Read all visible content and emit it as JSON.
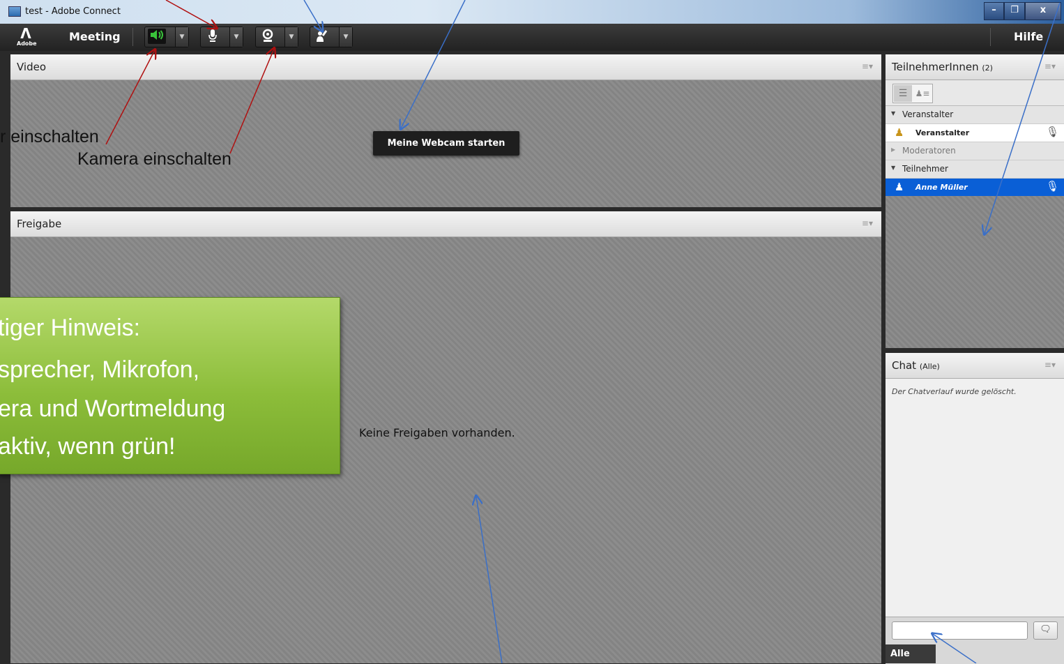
{
  "window": {
    "title": "test - Adobe Connect",
    "minimize": "–",
    "maximize": "❐",
    "close": "x"
  },
  "menubar": {
    "logo_text": "Adobe",
    "meeting": "Meeting",
    "help": "Hilfe"
  },
  "video_pod": {
    "title": "Video",
    "webcam_button": "Meine Webcam starten"
  },
  "share_pod": {
    "title": "Freigabe",
    "empty_text": "Keine Freigaben vorhanden."
  },
  "attendees": {
    "title": "TeilnehmerInnen",
    "count": "(2)",
    "groups": [
      {
        "label": "Veranstalter",
        "members": [
          "Veranstalter"
        ]
      },
      {
        "label": "Moderatoren",
        "members": []
      },
      {
        "label": "Teilnehmer",
        "members": [
          "Anne Müller"
        ]
      }
    ]
  },
  "chat": {
    "title": "Chat",
    "scope": "(Alle)",
    "message": "Der Chatverlauf wurde gelöscht.",
    "recipient": "Alle"
  },
  "annotations": {
    "speaker": "r einschalten",
    "camera": "Kamera einschalten",
    "hint_lines": [
      "tiger Hinweis:",
      "sprecher, Mikrofon,",
      "era und Wortmeldung",
      "aktiv, wenn grün!"
    ]
  },
  "colors": {
    "active_green": "#39c43a",
    "selected_row": "#0a5fd6",
    "hint_box": "#8cbd3a"
  }
}
